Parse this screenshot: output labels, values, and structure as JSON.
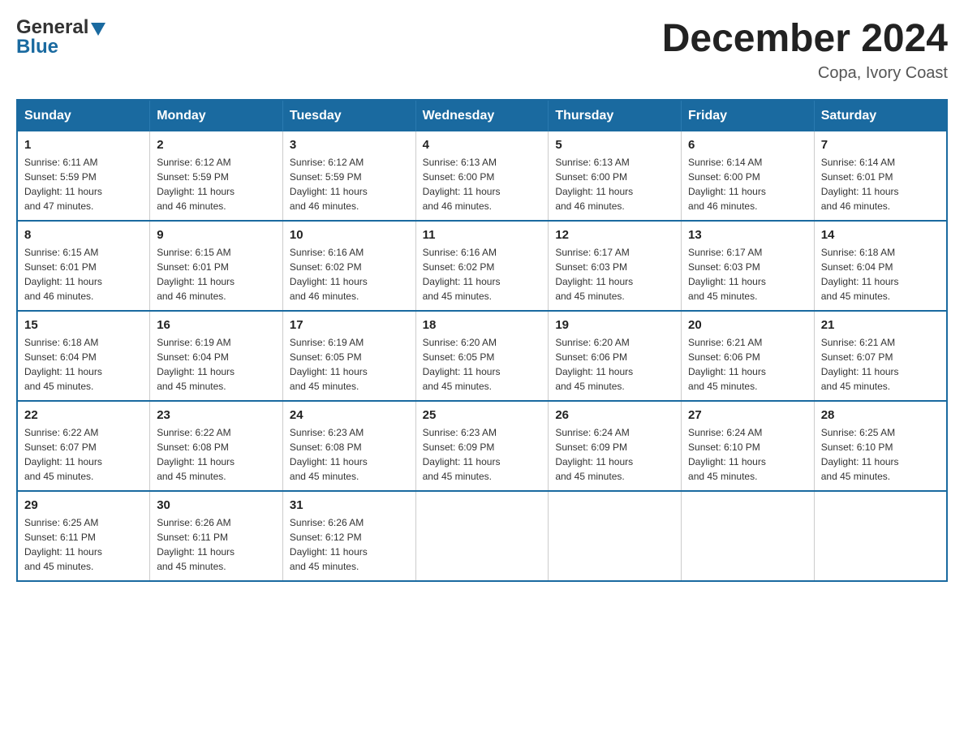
{
  "header": {
    "logo": {
      "general": "General",
      "blue": "Blue"
    },
    "title": "December 2024",
    "location": "Copa, Ivory Coast"
  },
  "weekdays": [
    "Sunday",
    "Monday",
    "Tuesday",
    "Wednesday",
    "Thursday",
    "Friday",
    "Saturday"
  ],
  "weeks": [
    [
      {
        "day": "1",
        "sunrise": "6:11 AM",
        "sunset": "5:59 PM",
        "daylight": "11 hours and 47 minutes."
      },
      {
        "day": "2",
        "sunrise": "6:12 AM",
        "sunset": "5:59 PM",
        "daylight": "11 hours and 46 minutes."
      },
      {
        "day": "3",
        "sunrise": "6:12 AM",
        "sunset": "5:59 PM",
        "daylight": "11 hours and 46 minutes."
      },
      {
        "day": "4",
        "sunrise": "6:13 AM",
        "sunset": "6:00 PM",
        "daylight": "11 hours and 46 minutes."
      },
      {
        "day": "5",
        "sunrise": "6:13 AM",
        "sunset": "6:00 PM",
        "daylight": "11 hours and 46 minutes."
      },
      {
        "day": "6",
        "sunrise": "6:14 AM",
        "sunset": "6:00 PM",
        "daylight": "11 hours and 46 minutes."
      },
      {
        "day": "7",
        "sunrise": "6:14 AM",
        "sunset": "6:01 PM",
        "daylight": "11 hours and 46 minutes."
      }
    ],
    [
      {
        "day": "8",
        "sunrise": "6:15 AM",
        "sunset": "6:01 PM",
        "daylight": "11 hours and 46 minutes."
      },
      {
        "day": "9",
        "sunrise": "6:15 AM",
        "sunset": "6:01 PM",
        "daylight": "11 hours and 46 minutes."
      },
      {
        "day": "10",
        "sunrise": "6:16 AM",
        "sunset": "6:02 PM",
        "daylight": "11 hours and 46 minutes."
      },
      {
        "day": "11",
        "sunrise": "6:16 AM",
        "sunset": "6:02 PM",
        "daylight": "11 hours and 45 minutes."
      },
      {
        "day": "12",
        "sunrise": "6:17 AM",
        "sunset": "6:03 PM",
        "daylight": "11 hours and 45 minutes."
      },
      {
        "day": "13",
        "sunrise": "6:17 AM",
        "sunset": "6:03 PM",
        "daylight": "11 hours and 45 minutes."
      },
      {
        "day": "14",
        "sunrise": "6:18 AM",
        "sunset": "6:04 PM",
        "daylight": "11 hours and 45 minutes."
      }
    ],
    [
      {
        "day": "15",
        "sunrise": "6:18 AM",
        "sunset": "6:04 PM",
        "daylight": "11 hours and 45 minutes."
      },
      {
        "day": "16",
        "sunrise": "6:19 AM",
        "sunset": "6:04 PM",
        "daylight": "11 hours and 45 minutes."
      },
      {
        "day": "17",
        "sunrise": "6:19 AM",
        "sunset": "6:05 PM",
        "daylight": "11 hours and 45 minutes."
      },
      {
        "day": "18",
        "sunrise": "6:20 AM",
        "sunset": "6:05 PM",
        "daylight": "11 hours and 45 minutes."
      },
      {
        "day": "19",
        "sunrise": "6:20 AM",
        "sunset": "6:06 PM",
        "daylight": "11 hours and 45 minutes."
      },
      {
        "day": "20",
        "sunrise": "6:21 AM",
        "sunset": "6:06 PM",
        "daylight": "11 hours and 45 minutes."
      },
      {
        "day": "21",
        "sunrise": "6:21 AM",
        "sunset": "6:07 PM",
        "daylight": "11 hours and 45 minutes."
      }
    ],
    [
      {
        "day": "22",
        "sunrise": "6:22 AM",
        "sunset": "6:07 PM",
        "daylight": "11 hours and 45 minutes."
      },
      {
        "day": "23",
        "sunrise": "6:22 AM",
        "sunset": "6:08 PM",
        "daylight": "11 hours and 45 minutes."
      },
      {
        "day": "24",
        "sunrise": "6:23 AM",
        "sunset": "6:08 PM",
        "daylight": "11 hours and 45 minutes."
      },
      {
        "day": "25",
        "sunrise": "6:23 AM",
        "sunset": "6:09 PM",
        "daylight": "11 hours and 45 minutes."
      },
      {
        "day": "26",
        "sunrise": "6:24 AM",
        "sunset": "6:09 PM",
        "daylight": "11 hours and 45 minutes."
      },
      {
        "day": "27",
        "sunrise": "6:24 AM",
        "sunset": "6:10 PM",
        "daylight": "11 hours and 45 minutes."
      },
      {
        "day": "28",
        "sunrise": "6:25 AM",
        "sunset": "6:10 PM",
        "daylight": "11 hours and 45 minutes."
      }
    ],
    [
      {
        "day": "29",
        "sunrise": "6:25 AM",
        "sunset": "6:11 PM",
        "daylight": "11 hours and 45 minutes."
      },
      {
        "day": "30",
        "sunrise": "6:26 AM",
        "sunset": "6:11 PM",
        "daylight": "11 hours and 45 minutes."
      },
      {
        "day": "31",
        "sunrise": "6:26 AM",
        "sunset": "6:12 PM",
        "daylight": "11 hours and 45 minutes."
      },
      null,
      null,
      null,
      null
    ]
  ],
  "labels": {
    "sunrise": "Sunrise:",
    "sunset": "Sunset:",
    "daylight": "Daylight:"
  }
}
